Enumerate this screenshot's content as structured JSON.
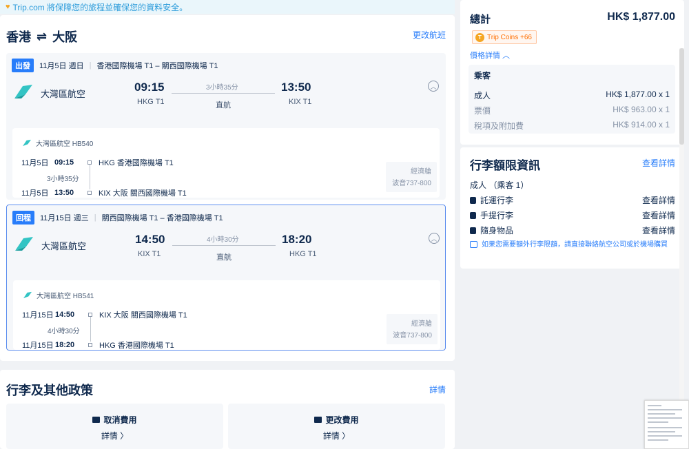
{
  "banner": {
    "text": "Trip.com 將保障您的旅程並確保您的資料安全。"
  },
  "route": {
    "from": "香港",
    "to": "大阪",
    "change_label": "更改航班"
  },
  "segments": [
    {
      "tag": "出發",
      "date": "11月5日 週日",
      "airports": "香港國際機場 T1 – 關西國際機場 T1",
      "airline": "大灣區航空",
      "dep_time": "09:15",
      "dep_code": "HKG T1",
      "arr_time": "13:50",
      "arr_code": "KIX T1",
      "duration": "3小時35分",
      "stops": "直航",
      "detail": {
        "flight": "大灣區航空 HB540",
        "dep_date": "11月5日",
        "dep_time": "09:15",
        "dep_airport": "HKG 香港國際機場 T1",
        "duration": "3小時35分",
        "arr_date": "11月5日",
        "arr_time": "13:50",
        "arr_airport": "KIX 大阪 關西國際機場 T1",
        "cabin": "經濟艙",
        "aircraft": "波音737-800"
      }
    },
    {
      "tag": "回程",
      "date": "11月15日 週三",
      "airports": "關西國際機場 T1 – 香港國際機場 T1",
      "airline": "大灣區航空",
      "dep_time": "14:50",
      "dep_code": "KIX T1",
      "arr_time": "18:20",
      "arr_code": "HKG T1",
      "duration": "4小時30分",
      "stops": "直航",
      "detail": {
        "flight": "大灣區航空 HB541",
        "dep_date": "11月15日",
        "dep_time": "14:50",
        "dep_airport": "KIX 大阪 關西國際機場 T1",
        "duration": "4小時30分",
        "arr_date": "11月15日",
        "arr_time": "18:20",
        "arr_airport": "HKG 香港國際機場 T1",
        "cabin": "經濟艙",
        "aircraft": "波音737-800"
      }
    }
  ],
  "policy": {
    "title": "行李及其他政策",
    "detail_label": "詳情",
    "cancel_title": "取消費用",
    "cancel_link": "詳情 〉",
    "change_title": "更改費用",
    "change_link": "詳情 〉"
  },
  "summary": {
    "total_label": "總計",
    "total_value": "HK$ 1,877.00",
    "coins": "Trip Coins +66",
    "price_detail": "價格詳情 ︿",
    "pax_title": "乘客",
    "rows": [
      {
        "label": "成人",
        "value": "HK$ 1,877.00 x 1"
      },
      {
        "label": "票價",
        "value": "HK$ 963.00 x 1"
      },
      {
        "label": "稅項及附加費",
        "value": "HK$ 914.00 x 1"
      }
    ]
  },
  "baggage": {
    "title": "行李額限資訊",
    "view_label": "查看詳情",
    "pax": "成人 （乘客 1）",
    "items": [
      {
        "label": "託運行李",
        "link": "查看詳情"
      },
      {
        "label": "手提行李",
        "link": "查看詳情"
      },
      {
        "label": "隨身物品",
        "link": "查看詳情"
      }
    ],
    "note": "如果您需要額外行李限額，請直接聯絡航空公司或於機場購買"
  },
  "colors": {
    "accent": "#287dfa",
    "text": "#0f294d",
    "brand_logo": "#33c4c4",
    "coins": "#ff6f00"
  }
}
